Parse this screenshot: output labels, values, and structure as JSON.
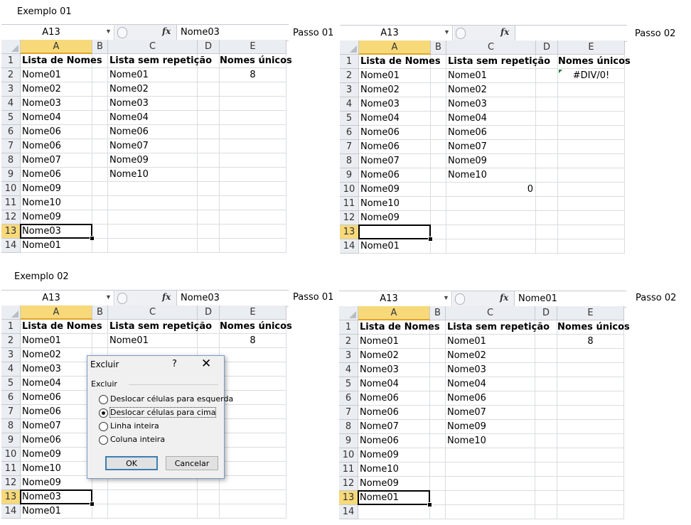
{
  "captions": {
    "ex1": "Exemplo 01",
    "ex2": "Exemplo 02"
  },
  "steps": {
    "p1": "Passo 01",
    "p2": "Passo 02"
  },
  "columns": [
    "A",
    "B",
    "C",
    "D",
    "E"
  ],
  "headers": {
    "a": "Lista de Nomes",
    "c": "Lista sem repetição",
    "e": "Nomes únicos"
  },
  "rownums": [
    "1",
    "2",
    "3",
    "4",
    "5",
    "6",
    "7",
    "8",
    "9",
    "10",
    "11",
    "12",
    "13",
    "14"
  ],
  "sheets": {
    "s1": {
      "namebox": "A13",
      "formula": "Nome03",
      "colA": [
        "Nome01",
        "Nome02",
        "Nome03",
        "Nome04",
        "Nome06",
        "Nome06",
        "Nome07",
        "Nome06",
        "Nome09",
        "Nome10",
        "Nome09",
        "Nome03",
        "Nome01"
      ],
      "colC": [
        "Nome01",
        "Nome02",
        "Nome03",
        "Nome04",
        "Nome06",
        "Nome07",
        "Nome09",
        "Nome10"
      ],
      "e2": "8"
    },
    "s2": {
      "namebox": "A13",
      "formula": "",
      "colA": [
        "Nome01",
        "Nome02",
        "Nome03",
        "Nome04",
        "Nome06",
        "Nome06",
        "Nome07",
        "Nome06",
        "Nome09",
        "Nome10",
        "Nome09",
        "",
        "Nome01"
      ],
      "colC": [
        "Nome01",
        "Nome02",
        "Nome03",
        "Nome04",
        "Nome06",
        "Nome07",
        "Nome09",
        "Nome10"
      ],
      "c10": "0",
      "e2": "#DIV/0!"
    },
    "s3": {
      "namebox": "A13",
      "formula": "Nome03",
      "colA": [
        "Nome01",
        "Nome02",
        "Nome03",
        "Nome04",
        "Nome06",
        "Nome06",
        "Nome07",
        "Nome06",
        "Nome09",
        "Nome10",
        "Nome09",
        "Nome03",
        "Nome01"
      ],
      "c2": "Nome01",
      "e2": "8"
    },
    "s4": {
      "namebox": "A13",
      "formula": "Nome01",
      "colA": [
        "Nome01",
        "Nome02",
        "Nome03",
        "Nome04",
        "Nome06",
        "Nome06",
        "Nome07",
        "Nome06",
        "Nome09",
        "Nome10",
        "Nome09",
        "Nome01",
        ""
      ],
      "colC": [
        "Nome01",
        "Nome02",
        "Nome03",
        "Nome04",
        "Nome06",
        "Nome07",
        "Nome09",
        "Nome10"
      ],
      "e2": "8"
    }
  },
  "dialog": {
    "title": "Excluir",
    "help": "?",
    "close": "✕",
    "group": "Excluir",
    "options": [
      "Deslocar células para esquerda",
      "Deslocar células para cima",
      "Linha inteira",
      "Coluna inteira"
    ],
    "ok": "OK",
    "cancel": "Cancelar"
  },
  "colors": {
    "selected_header": "#f7d97a",
    "header_bg": "#eaedf1",
    "grid": "#d9dce0",
    "error_flag": "#1e7b34"
  }
}
